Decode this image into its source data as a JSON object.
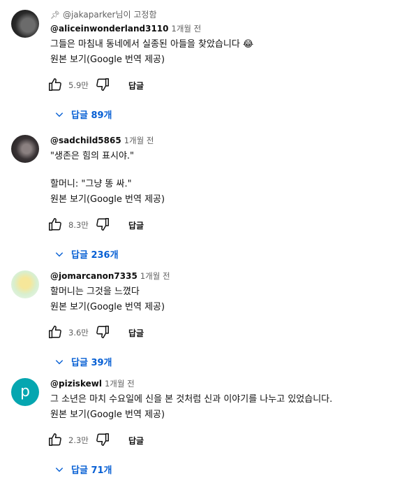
{
  "comments": [
    {
      "pinned_by": "@jakaparker님이 고정함",
      "author": "@aliceinwonderland3110",
      "time": "1개월 전",
      "text": "그들은 마침내 동네에서 실종된 아들을 찾았습니다 😂",
      "translate_label": "원본 보기(Google 번역 제공)",
      "likes": "5.9만",
      "reply_label": "답글",
      "replies_label": "답글 89개",
      "avatar": "dark-photo"
    },
    {
      "author": "@sadchild5865",
      "time": "1개월 전",
      "text": "\"생존은 힘의 표시야.\"\n\n할머니: \"그냥 똥 싸.\"",
      "translate_label": "원본 보기(Google 번역 제공)",
      "likes": "8.3만",
      "reply_label": "답글",
      "replies_label": "답글 236개",
      "avatar": "dark-photo"
    },
    {
      "author": "@jomarcanon7335",
      "time": "1개월 전",
      "text": "할머니는 그것을 느꼈다",
      "translate_label": "원본 보기(Google 번역 제공)",
      "likes": "3.6만",
      "reply_label": "답글",
      "replies_label": "답글 39개",
      "avatar": "illustration"
    },
    {
      "author": "@piziskewl",
      "time": "1개월 전",
      "text": "그 소년은 마치 수요일에 신을 본 것처럼 신과 이야기를 나누고 있었습니다.",
      "translate_label": "원본 보기(Google 번역 제공)",
      "likes": "2.3만",
      "reply_label": "답글",
      "replies_label": "답글 71개",
      "avatar_letter": "p",
      "avatar_color": "#05a6b0"
    }
  ],
  "colors": {
    "link": "#065fd4",
    "muted": "#606060",
    "text": "#0f0f0f"
  },
  "icons": [
    "pin-icon",
    "thumbs-up-icon",
    "thumbs-down-icon",
    "chevron-down-icon"
  ]
}
